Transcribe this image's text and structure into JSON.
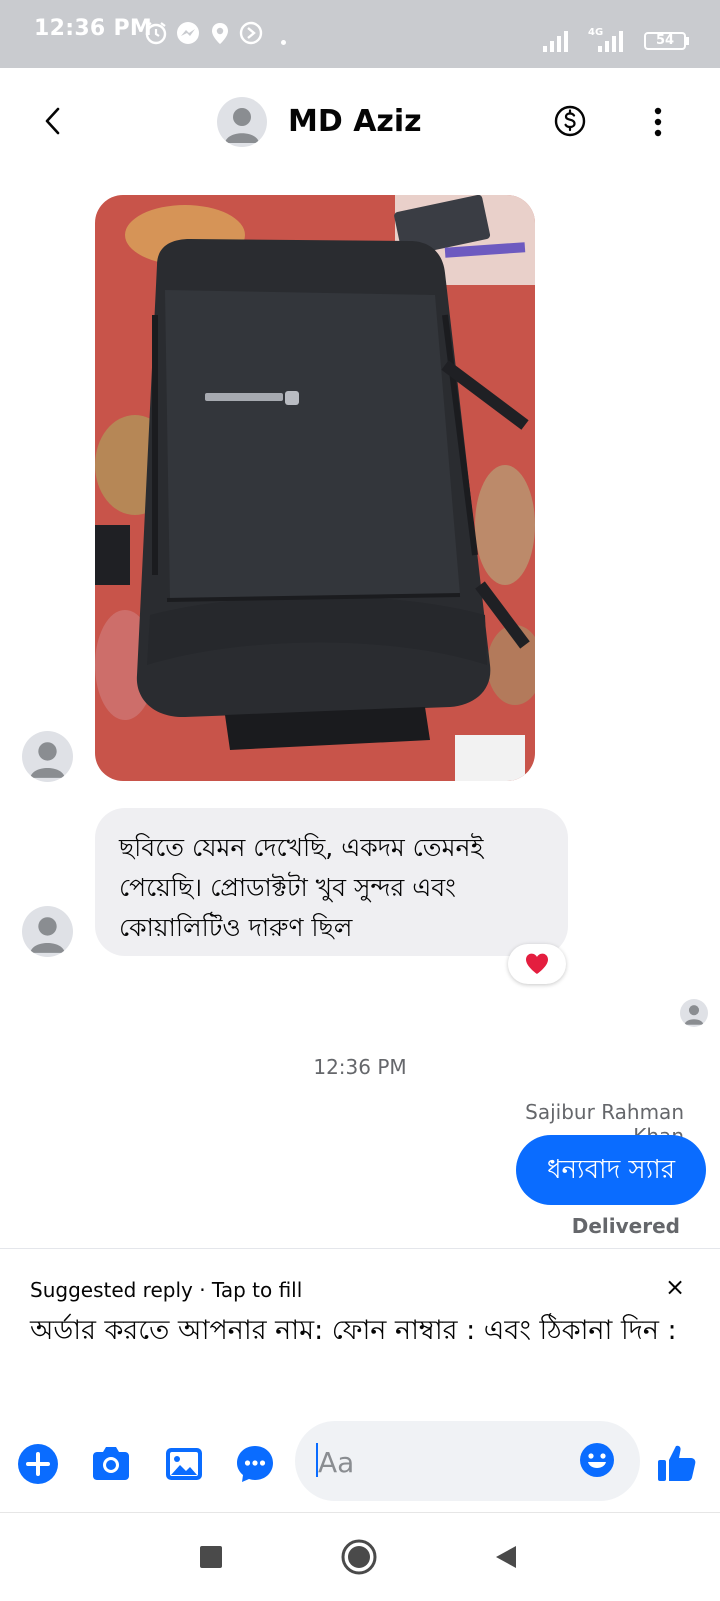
{
  "status": {
    "time": "12:36 PM",
    "battery": "54",
    "network": "4G"
  },
  "header": {
    "contact_name": "MD Aziz",
    "back_icon": "back-arrow-icon",
    "payment_icon": "dollar-circle-icon",
    "more_icon": "more-vertical-icon"
  },
  "conversation": {
    "incoming_message": "ছবিতে যেমন দেখেছি, একদম তেমনই পেয়েছি। প্রোডাক্টটা খুব সুন্দর এবং কোয়ালিটিও দারুণ ছিল",
    "reaction": "heart-icon",
    "time_separator": "12:36 PM",
    "outgoing_sender": "Sajibur Rahman Khan",
    "outgoing_message": "ধন্যবাদ স্যার",
    "delivery_status": "Delivered"
  },
  "suggested_reply": {
    "label": "Suggested reply · Tap to fill",
    "close": "×",
    "text": "অর্ডার করতে আপনার নাম: ফোন নাম্বার : এবং ঠিকানা দিন :"
  },
  "composer": {
    "placeholder": "Aa"
  },
  "colors": {
    "accent": "#0a6cff",
    "bubble_in": "#efeff2",
    "status_bar": "#c9cbcf",
    "reaction_heart": "#e41e3f"
  }
}
